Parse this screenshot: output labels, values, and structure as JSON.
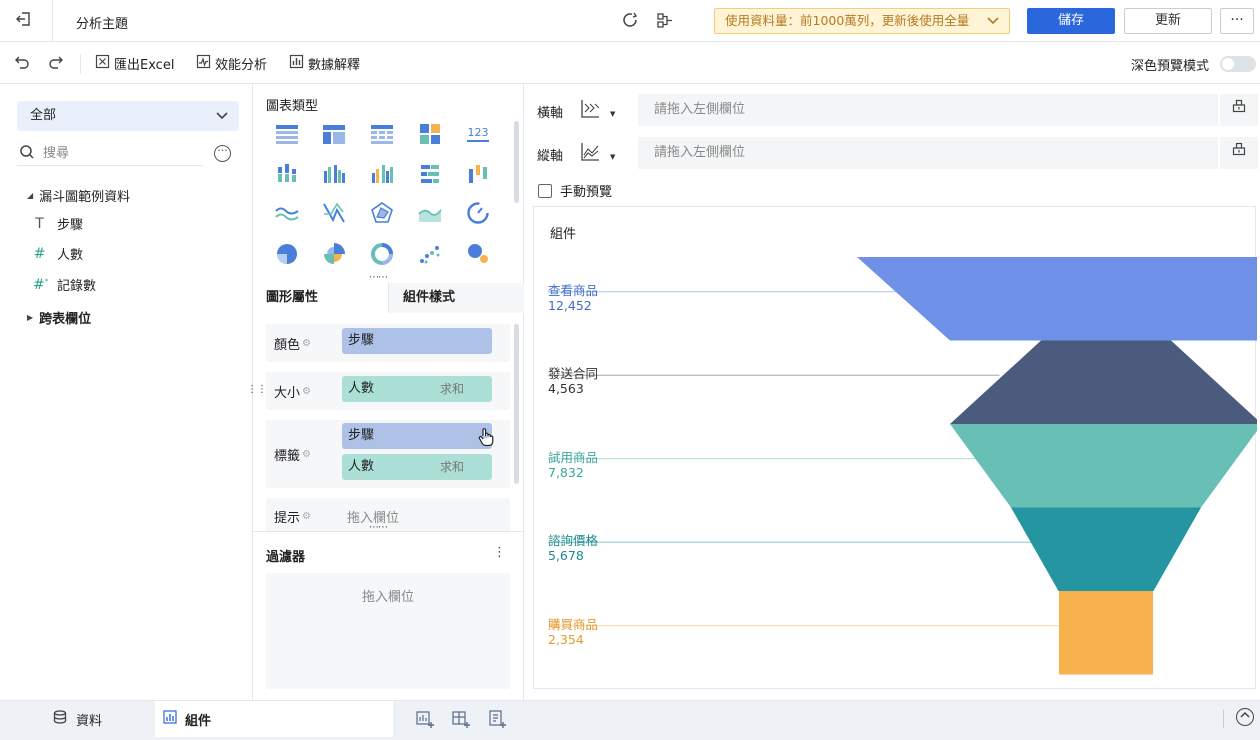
{
  "header": {
    "title": "分析主題",
    "usage_text": "使用資料量：前1000萬列，更新後使用全量",
    "save_label": "儲存",
    "update_label": "更新",
    "more_label": "···"
  },
  "toolbar": {
    "export_label": "匯出Excel",
    "perf_label": "效能分析",
    "explain_label": "數據解釋",
    "dark_mode_label": "深色預覽模式",
    "dark_mode_on": false
  },
  "left": {
    "dataset_select": "全部",
    "search_placeholder": "搜尋",
    "tree_root": "漏斗圖範例資料",
    "fields": [
      {
        "icon": "T",
        "label": "步驟"
      },
      {
        "icon": "#",
        "label": "人數"
      },
      {
        "icon": "#",
        "label": "記錄數"
      }
    ],
    "cross_table": "跨表欄位"
  },
  "middle": {
    "chart_type_title": "圖表類型",
    "tab_active": "圖形屬性",
    "tab_inactive": "組件樣式",
    "props": {
      "color_label": "顏色",
      "color_field": "步驟",
      "size_label": "大小",
      "size_field": "人數",
      "size_agg": "求和",
      "label_label": "標籤",
      "label_field1": "步驟",
      "label_field2": "人數",
      "label_agg": "求和",
      "tip_label": "提示",
      "tip_placeholder": "拖入欄位"
    },
    "filter_title": "過濾器",
    "filter_placeholder": "拖入欄位"
  },
  "right": {
    "x_axis_label": "橫軸",
    "y_axis_label": "縱軸",
    "axis_placeholder": "請拖入左側欄位",
    "manual_preview": "手動預覽",
    "canvas_title": "組件"
  },
  "chart_data": {
    "type": "funnel",
    "categories": [
      "查看商品",
      "發送合同",
      "試用商品",
      "諮詢價格",
      "購買商品"
    ],
    "values": [
      12452,
      4563,
      7832,
      5678,
      2354
    ],
    "value_labels": [
      "12,452",
      "4,563",
      "7,832",
      "5,678",
      "2,354"
    ],
    "colors": [
      "#6e90e6",
      "#4a5b7e",
      "#67bfb5",
      "#2596a1",
      "#f7b24e"
    ],
    "label_colors": [
      "#3e6bc9",
      "#333333",
      "#3aa597",
      "#1e8b8f",
      "#e39a2f"
    ]
  },
  "bottom": {
    "tab_data": "資料",
    "tab_component": "組件"
  }
}
